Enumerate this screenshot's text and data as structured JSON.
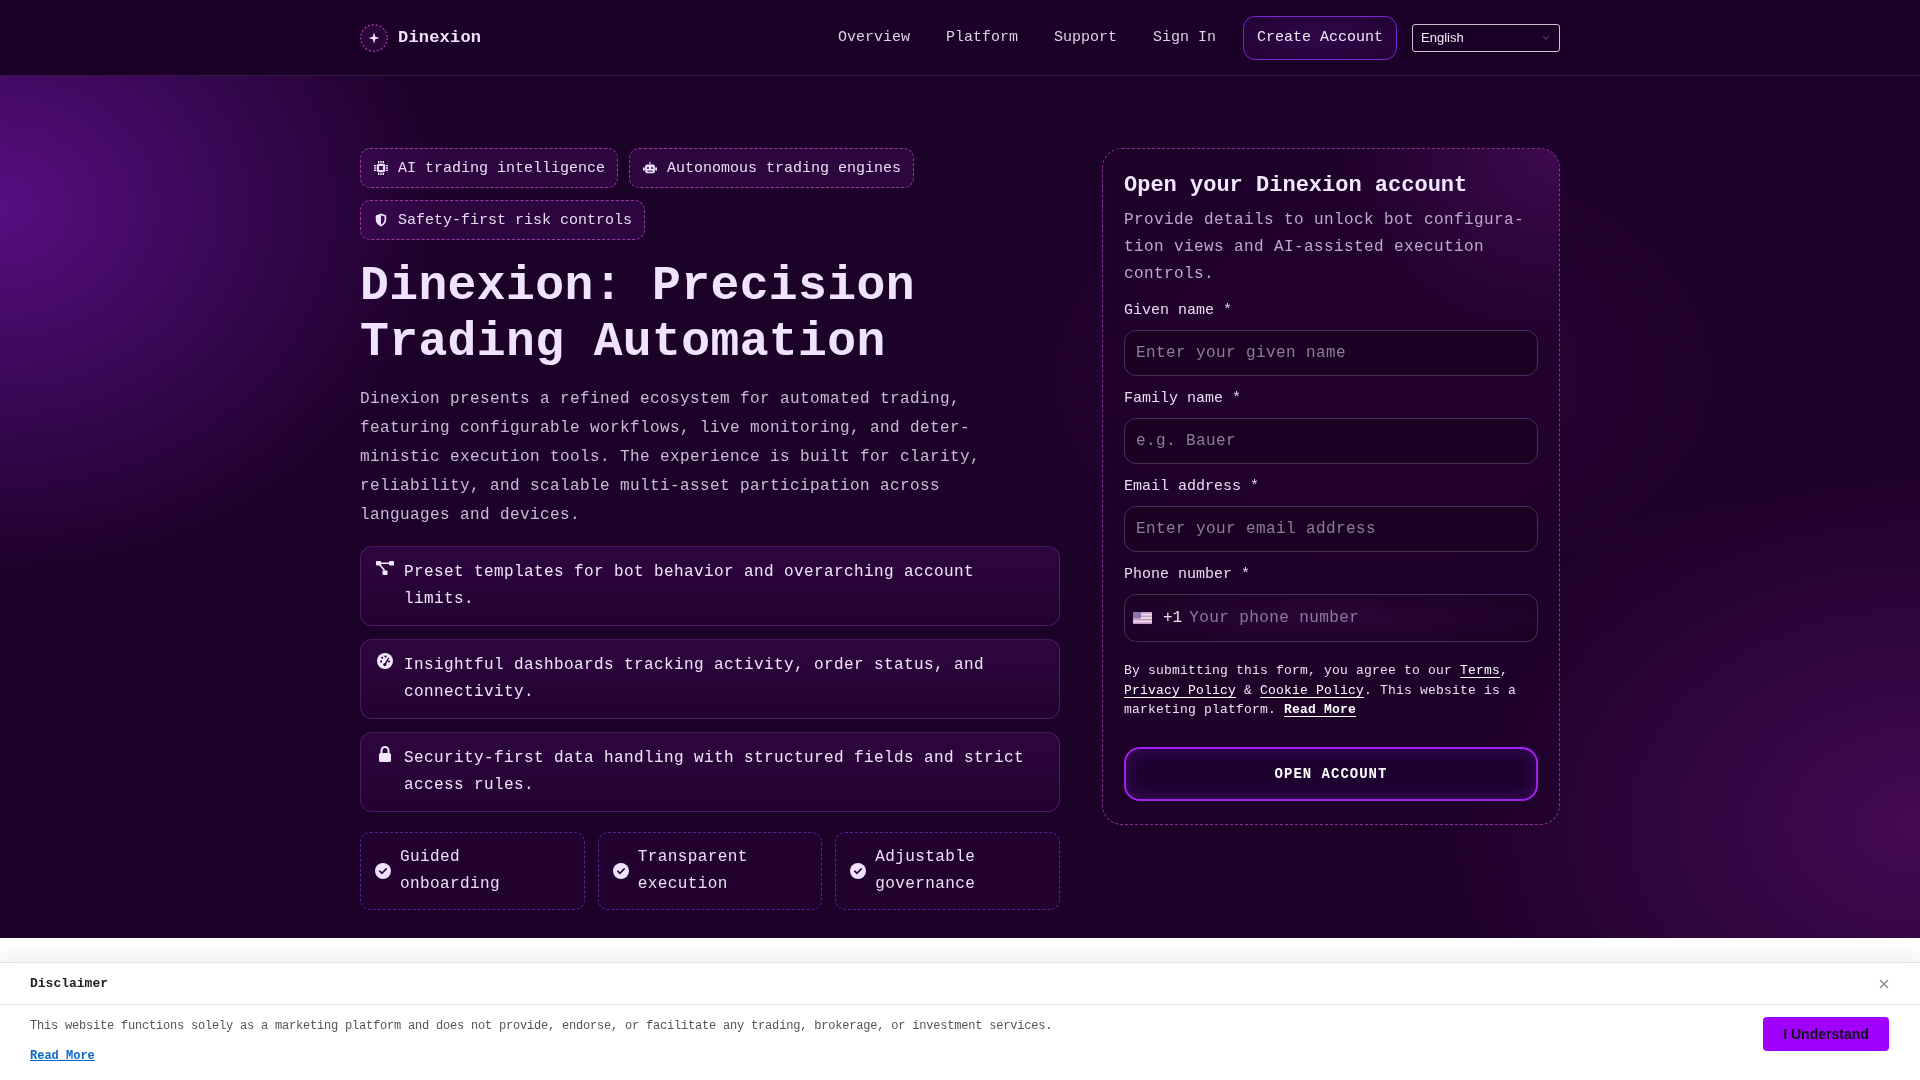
{
  "header": {
    "brand": "Dinexion",
    "nav": [
      "Overview",
      "Platform",
      "Support",
      "Sign In"
    ],
    "cta": "Create Account",
    "language": "English"
  },
  "hero": {
    "chips": [
      "AI trading intelligence",
      "Autonomous trading engines",
      "Safety-first risk controls"
    ],
    "title": "Dinexion: Precision Trading Automation",
    "intro": "Dinexion presents a refined ecosystem for automated trading, featuring configurable workflows, live monitoring, and deter-ministic execution tools. The experience is built for clarity, reliability, and scalable multi-asset participation across languages and devices.",
    "features": [
      "Preset templates for bot behavior and overarching account limits.",
      "Insightful dashboards tracking activity, order status, and connectivity.",
      "Security-first data handling with structured fields and strict access rules."
    ],
    "highlights": [
      "Guided onboarding",
      "Transparent execution",
      "Adjustable governance"
    ]
  },
  "signup": {
    "title": "Open your Dinexion account",
    "subtitle": "Provide details to unlock bot configura-tion views and AI-assisted execution controls.",
    "fields": [
      {
        "kind": "text",
        "label": "Given name *",
        "placeholder": "Enter your given name"
      },
      {
        "kind": "text",
        "label": "Family name *",
        "placeholder": "e.g. Bauer"
      },
      {
        "kind": "email",
        "label": "Email address *",
        "placeholder": "Enter your email address"
      },
      {
        "kind": "phone",
        "label": "Phone number *",
        "dial_code": "+1",
        "placeholder": "Your phone number"
      }
    ],
    "consent": [
      {
        "kind": "text",
        "text": "By submitting this form, you agree to our "
      },
      {
        "kind": "link",
        "text": "Terms"
      },
      {
        "kind": "text",
        "text": ", "
      },
      {
        "kind": "link",
        "text": "Privacy Policy"
      },
      {
        "kind": "text",
        "text": " & "
      },
      {
        "kind": "link",
        "text": "Cookie Policy"
      },
      {
        "kind": "text",
        "text": ". This website is a marketing platform. "
      },
      {
        "kind": "strong-link",
        "text": "Read More"
      }
    ],
    "submit": "OPEN ACCOUNT"
  },
  "disclaimer": {
    "title": "Disclaimer",
    "text": "This website functions solely as a marketing platform and does not provide, endorse, or facilitate any trading, brokerage, or investment services.",
    "link": "Read More",
    "button": "I Understand"
  }
}
